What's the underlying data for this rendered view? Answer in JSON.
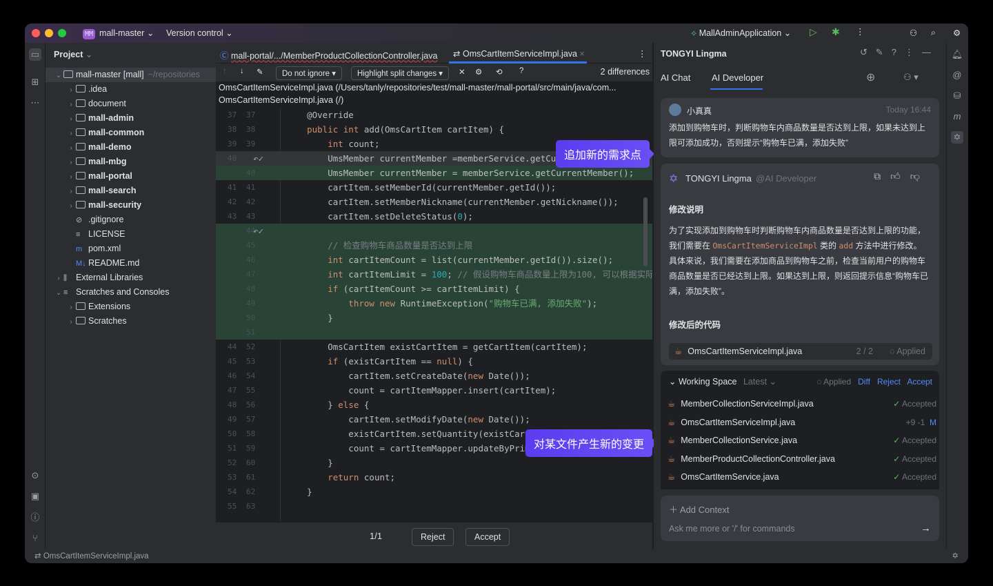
{
  "titlebar": {
    "project_badge": "MM",
    "project": "mall-master",
    "vcs": "Version control",
    "run_config": "MallAdminApplication"
  },
  "project": {
    "title": "Project",
    "tree": [
      {
        "label": "mall-master [mall]",
        "extra": "~/repositories",
        "indent": 0,
        "chev": "⌄",
        "icon": "folder",
        "sel": true
      },
      {
        "label": ".idea",
        "indent": 1,
        "chev": "›",
        "icon": "folder"
      },
      {
        "label": "document",
        "indent": 1,
        "chev": "›",
        "icon": "folder"
      },
      {
        "label": "mall-admin",
        "indent": 1,
        "chev": "›",
        "icon": "folder",
        "bold": true
      },
      {
        "label": "mall-common",
        "indent": 1,
        "chev": "›",
        "icon": "folder",
        "bold": true
      },
      {
        "label": "mall-demo",
        "indent": 1,
        "chev": "›",
        "icon": "folder",
        "bold": true
      },
      {
        "label": "mall-mbg",
        "indent": 1,
        "chev": "›",
        "icon": "folder",
        "bold": true
      },
      {
        "label": "mall-portal",
        "indent": 1,
        "chev": "›",
        "icon": "folder",
        "bold": true
      },
      {
        "label": "mall-search",
        "indent": 1,
        "chev": "›",
        "icon": "folder",
        "bold": true
      },
      {
        "label": "mall-security",
        "indent": 1,
        "chev": "›",
        "icon": "folder",
        "bold": true
      },
      {
        "label": ".gitignore",
        "indent": 1,
        "chev": "",
        "icon": "ignore"
      },
      {
        "label": "LICENSE",
        "indent": 1,
        "chev": "",
        "icon": "text"
      },
      {
        "label": "pom.xml",
        "indent": 1,
        "chev": "",
        "icon": "maven"
      },
      {
        "label": "README.md",
        "indent": 1,
        "chev": "",
        "icon": "markdown"
      },
      {
        "label": "External Libraries",
        "indent": 0,
        "chev": "›",
        "icon": "library"
      },
      {
        "label": "Scratches and Consoles",
        "indent": 0,
        "chev": "⌄",
        "icon": "scratches"
      },
      {
        "label": "Extensions",
        "indent": 1,
        "chev": "›",
        "icon": "folder"
      },
      {
        "label": "Scratches",
        "indent": 1,
        "chev": "›",
        "icon": "folder"
      }
    ]
  },
  "editor": {
    "tabs": [
      {
        "label": "mall-portal/.../MemberProductCollectionController.java"
      },
      {
        "label": "OmsCartItemServiceImpl.java",
        "active": true
      }
    ],
    "ignore_option": "Do not ignore",
    "highlight_option": "Highlight split changes",
    "differences": "2 differences",
    "left_path": "OmsCartItemServiceImpl.java (/Users/tanly/repositories/test/mall-master/mall-portal/src/main/java/com...",
    "right_path": "OmsCartItemServiceImpl.java (/)",
    "lines": [
      {
        "n1": "37",
        "n2": "37",
        "t": [
          [
            "p",
            "    @Override"
          ]
        ]
      },
      {
        "n1": "38",
        "n2": "38",
        "t": [
          [
            "k",
            "    public int "
          ],
          [
            "p",
            "add(OmsCartItem cartItem) {"
          ]
        ]
      },
      {
        "n1": "39",
        "n2": "39",
        "t": [
          [
            "k",
            "        int "
          ],
          [
            "p",
            "count;"
          ]
        ]
      },
      {
        "n1": "40",
        "n2": "",
        "cls": "mod",
        "t": [
          [
            "p",
            "        UmsMember currentMember =memberService.getCurrentMember();"
          ]
        ]
      },
      {
        "n1": "",
        "n2": "40",
        "cls": "add",
        "t": [
          [
            "p",
            "        UmsMember currentMember = memberService.getCurrentMember();"
          ]
        ]
      },
      {
        "n1": "41",
        "n2": "41",
        "t": [
          [
            "p",
            "        cartItem.setMemberId(currentMember.getId());"
          ]
        ]
      },
      {
        "n1": "42",
        "n2": "42",
        "t": [
          [
            "p",
            "        cartItem.setMemberNickname(currentMember.getNickname());"
          ]
        ]
      },
      {
        "n1": "43",
        "n2": "43",
        "t": [
          [
            "p",
            "        cartItem.setDeleteStatus("
          ],
          [
            "num",
            "0"
          ],
          [
            "p",
            ");"
          ]
        ]
      },
      {
        "n1": "",
        "n2": "44",
        "cls": "add",
        "t": []
      },
      {
        "n1": "",
        "n2": "45",
        "cls": "add",
        "t": [
          [
            "c",
            "        // 检查购物车商品数量是否达到上限"
          ]
        ]
      },
      {
        "n1": "",
        "n2": "46",
        "cls": "add",
        "t": [
          [
            "k",
            "        int "
          ],
          [
            "p",
            "cartItemCount = list(currentMember.getId()).size();"
          ]
        ]
      },
      {
        "n1": "",
        "n2": "47",
        "cls": "add",
        "t": [
          [
            "k",
            "        int "
          ],
          [
            "p",
            "cartItemLimit = "
          ],
          [
            "num",
            "100"
          ],
          [
            "p",
            "; "
          ],
          [
            "c",
            "// 假设购物车商品数量上限为100, 可以根据实际需"
          ]
        ]
      },
      {
        "n1": "",
        "n2": "48",
        "cls": "add",
        "t": [
          [
            "k",
            "        if "
          ],
          [
            "p",
            "(cartItemCount >= cartItemLimit) {"
          ]
        ]
      },
      {
        "n1": "",
        "n2": "49",
        "cls": "add",
        "t": [
          [
            "k",
            "            throw new "
          ],
          [
            "p",
            "RuntimeException("
          ],
          [
            "s",
            "\"购物车已满, 添加失败\""
          ],
          [
            "p",
            ");"
          ]
        ]
      },
      {
        "n1": "",
        "n2": "50",
        "cls": "add",
        "t": [
          [
            "p",
            "        }"
          ]
        ]
      },
      {
        "n1": "",
        "n2": "51",
        "cls": "add",
        "t": []
      },
      {
        "n1": "44",
        "n2": "52",
        "t": [
          [
            "p",
            "        OmsCartItem existCartItem = getCartItem(cartItem);"
          ]
        ]
      },
      {
        "n1": "45",
        "n2": "53",
        "t": [
          [
            "k",
            "        if "
          ],
          [
            "p",
            "(existCartItem == "
          ],
          [
            "k",
            "null"
          ],
          [
            "p",
            ") {"
          ]
        ]
      },
      {
        "n1": "46",
        "n2": "54",
        "t": [
          [
            "p",
            "            cartItem.setCreateDate("
          ],
          [
            "k",
            "new "
          ],
          [
            "p",
            "Date());"
          ]
        ]
      },
      {
        "n1": "47",
        "n2": "55",
        "t": [
          [
            "p",
            "            count = cartItemMapper.insert(cartItem);"
          ]
        ]
      },
      {
        "n1": "48",
        "n2": "56",
        "t": [
          [
            "p",
            "        } "
          ],
          [
            "k",
            "else "
          ],
          [
            "p",
            "{"
          ]
        ]
      },
      {
        "n1": "49",
        "n2": "57",
        "t": [
          [
            "p",
            "            cartItem.setModifyDate("
          ],
          [
            "k",
            "new "
          ],
          [
            "p",
            "Date());"
          ]
        ]
      },
      {
        "n1": "50",
        "n2": "58",
        "t": [
          [
            "p",
            "            existCartItem.setQuantity(existCartItem.getQuantity() + cartI"
          ]
        ]
      },
      {
        "n1": "51",
        "n2": "59",
        "t": [
          [
            "p",
            "            count = cartItemMapper.updateByPrimaryKey(existCartItem);"
          ]
        ]
      },
      {
        "n1": "52",
        "n2": "60",
        "t": [
          [
            "p",
            "        }"
          ]
        ]
      },
      {
        "n1": "53",
        "n2": "61",
        "t": [
          [
            "k",
            "        return "
          ],
          [
            "p",
            "count;"
          ]
        ]
      },
      {
        "n1": "54",
        "n2": "62",
        "t": [
          [
            "p",
            "    }"
          ]
        ]
      },
      {
        "n1": "55",
        "n2": "63",
        "t": []
      }
    ],
    "counter": "1/1",
    "reject": "Reject",
    "accept": "Accept",
    "callout_top": "追加新的需求点",
    "callout_bottom": "对某文件产生新的变更"
  },
  "assistant": {
    "title": "TONGYI Lingma",
    "tabs": [
      "AI Chat",
      "AI Developer"
    ],
    "user": {
      "name": "小真真",
      "time": "Today 16:44",
      "message": "添加到购物车时，判断购物车内商品数量是否达到上限，如果未达到上限可添加成功，否则提示“购物车已满，添加失败”"
    },
    "reply": {
      "name": "TONGYI Lingma",
      "mention": "@AI Developer",
      "h1": "修改说明",
      "p_a": "为了实现添加到购物车时判断购物车内商品数量是否达到上限的功能，我们需要在 ",
      "code1": "OmsCartItemServiceImpl",
      "p_b": " 类的 ",
      "code2": "add",
      "p_c": " 方法中进行修改。具体来说，我们需要在添加商品到购物车之前，检查当前用户的购物车商品数量是否已经达到上限。如果达到上限，则返回提示信息“购物车已满，添加失败”。",
      "h2": "修改后的代码",
      "file": "OmsCartItemServiceImpl.java",
      "file_count": "2 / 2",
      "file_status": "Applied"
    },
    "workspace": {
      "title": "Working Space",
      "version": "Latest",
      "status": "Applied",
      "diff": "Diff",
      "reject": "Reject",
      "accept": "Accept",
      "files": [
        {
          "name": "MemberCollectionServiceImpl.java",
          "status": "Accepted"
        },
        {
          "name": "OmsCartItemServiceImpl.java",
          "stats": "+9 -1",
          "mark": "M"
        },
        {
          "name": "MemberCollectionService.java",
          "status": "Accepted"
        },
        {
          "name": "MemberProductCollectionController.java",
          "status": "Accepted"
        },
        {
          "name": "OmsCartItemService.java",
          "status": "Accepted"
        }
      ]
    },
    "add_context": "Add Context",
    "input_placeholder": "Ask me more or '/' for commands"
  },
  "status": {
    "file": "OmsCartItemServiceImpl.java"
  },
  "colors": {
    "accent": "#548af7",
    "added": "#294436",
    "callout": "#5b3cf0"
  }
}
